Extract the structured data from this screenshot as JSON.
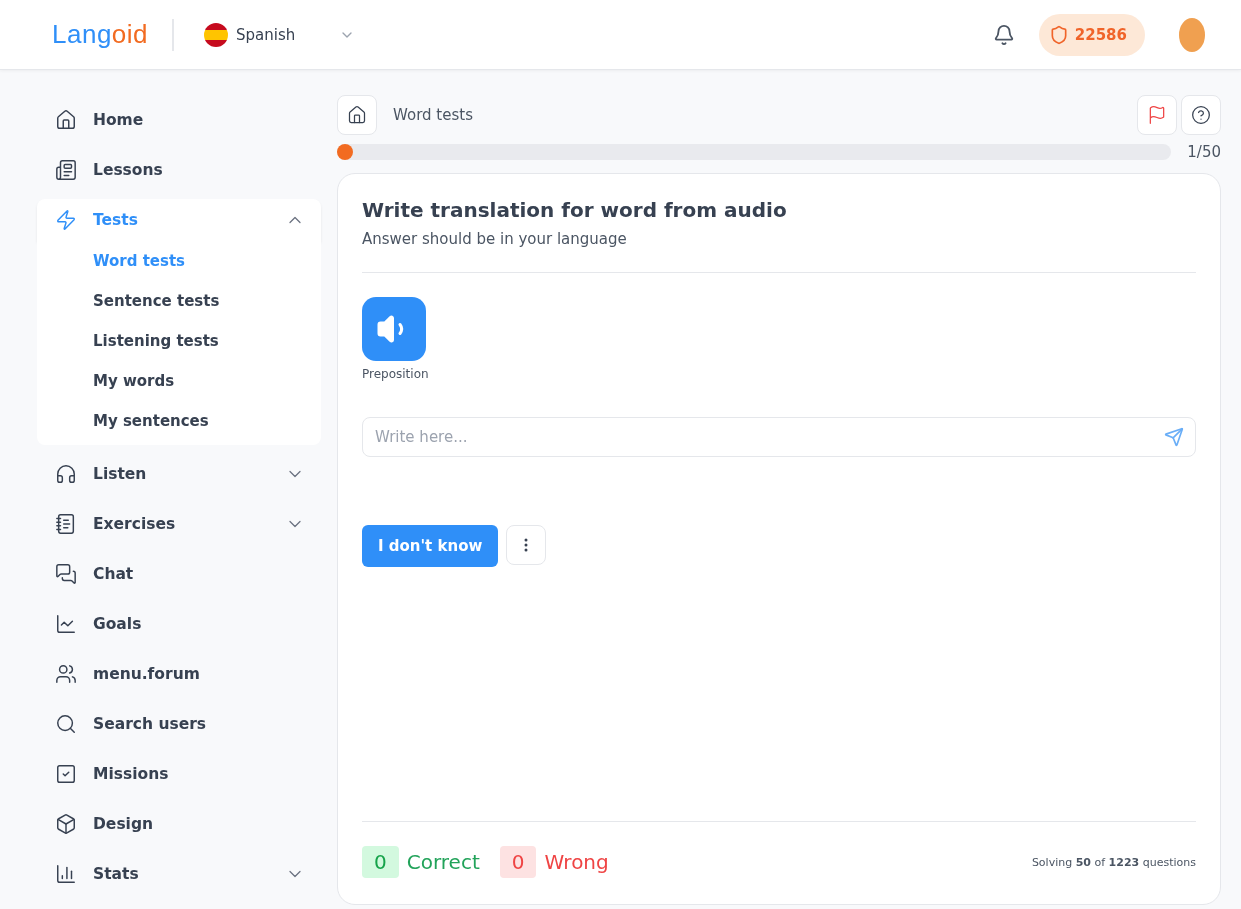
{
  "header": {
    "logo": [
      {
        "text": "Lang",
        "color": "#2f8ff8"
      },
      {
        "text": "oid",
        "color": "#f26b21"
      }
    ],
    "language": "Spanish",
    "points": "22586"
  },
  "sidebar": {
    "items": [
      {
        "label": "Home",
        "kind": "link",
        "selected": false
      },
      {
        "label": "Lessons",
        "kind": "link",
        "selected": false
      },
      {
        "label": "Tests",
        "kind": "group",
        "selected": true,
        "expanded": true,
        "children": [
          {
            "label": "Word tests",
            "selected": true
          },
          {
            "label": "Sentence tests",
            "selected": false
          },
          {
            "label": "Listening tests",
            "selected": false
          },
          {
            "label": "My words",
            "selected": false
          },
          {
            "label": "My sentences",
            "selected": false
          }
        ]
      },
      {
        "label": "Listen",
        "kind": "group",
        "selected": false,
        "expanded": false
      },
      {
        "label": "Exercises",
        "kind": "group",
        "selected": false,
        "expanded": false
      },
      {
        "label": "Chat",
        "kind": "link",
        "selected": false
      },
      {
        "label": "Goals",
        "kind": "link",
        "selected": false
      },
      {
        "label": "menu.forum",
        "kind": "link",
        "selected": false
      },
      {
        "label": "Search users",
        "kind": "link",
        "selected": false
      },
      {
        "label": "Missions",
        "kind": "link",
        "selected": false
      },
      {
        "label": "Design",
        "kind": "link",
        "selected": false
      },
      {
        "label": "Stats",
        "kind": "group",
        "selected": false,
        "expanded": false
      }
    ]
  },
  "breadcrumb": "Word tests",
  "progress": {
    "level": 0.0,
    "reading": "1/50"
  },
  "card": {
    "title": "Write translation for word from audio",
    "subtitle": "Answer should be in your language",
    "audio_label": "Preposition",
    "answer": {
      "placeholder": "Write here..."
    },
    "dont_know": "I don't know",
    "correct": {
      "count": "0",
      "label": "Correct"
    },
    "wrong": {
      "count": "0",
      "label": "Wrong"
    },
    "solving": "Solving **50** of **1223** questions"
  }
}
